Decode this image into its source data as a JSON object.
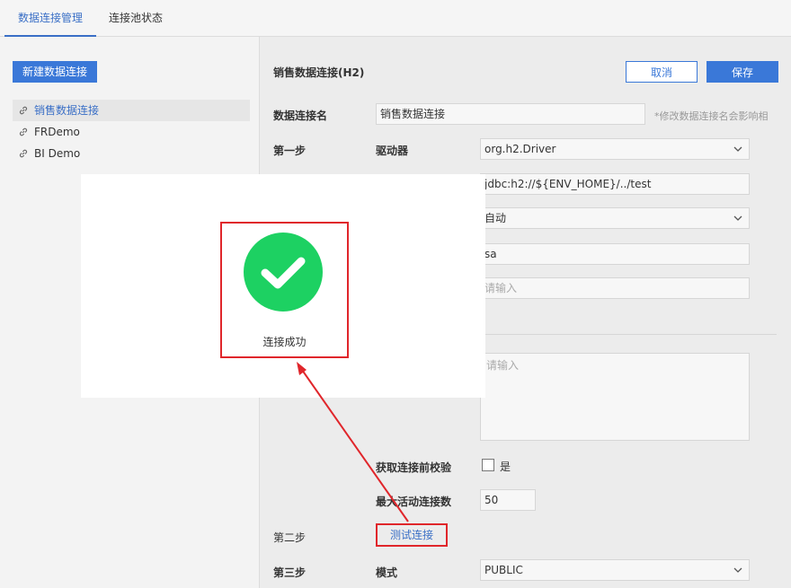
{
  "tabs": [
    {
      "label": "数据连接管理",
      "active": true
    },
    {
      "label": "连接池状态",
      "active": false
    }
  ],
  "sidebar": {
    "new_button": "新建数据连接",
    "connections": [
      {
        "label": "销售数据连接",
        "selected": true,
        "icon": "link-icon"
      },
      {
        "label": "FRDemo",
        "selected": false,
        "icon": "link-icon"
      },
      {
        "label": "BI Demo",
        "selected": false,
        "icon": "link-icon"
      }
    ]
  },
  "main": {
    "title": "销售数据连接(H2)",
    "cancel_label": "取消",
    "save_label": "保存",
    "name_label": "数据连接名",
    "name_value": "销售数据连接",
    "name_hint": "*修改数据连接名会影响相",
    "step1_label": "第一步",
    "driver_label": "驱动器",
    "driver_value": "org.h2.Driver",
    "url_value": "jdbc:h2://${ENV_HOME}/../test",
    "encoding_value": "自动",
    "username_value": "sa",
    "password_placeholder": "请输入",
    "sql_placeholder": "请输入",
    "validate_label": "获取连接前校验",
    "validate_option": "是",
    "max_active_label": "最大活动连接数",
    "max_active_value": "50",
    "step2_label": "第二步",
    "test_connection_label": "测试连接",
    "step3_label": "第三步",
    "schema_label": "模式",
    "schema_value": "PUBLIC"
  },
  "modal": {
    "message": "连接成功",
    "icon": "check-circle-icon"
  },
  "colors": {
    "accent": "#3a78d8",
    "success": "#1dd162",
    "annotation": "#e0262b"
  }
}
